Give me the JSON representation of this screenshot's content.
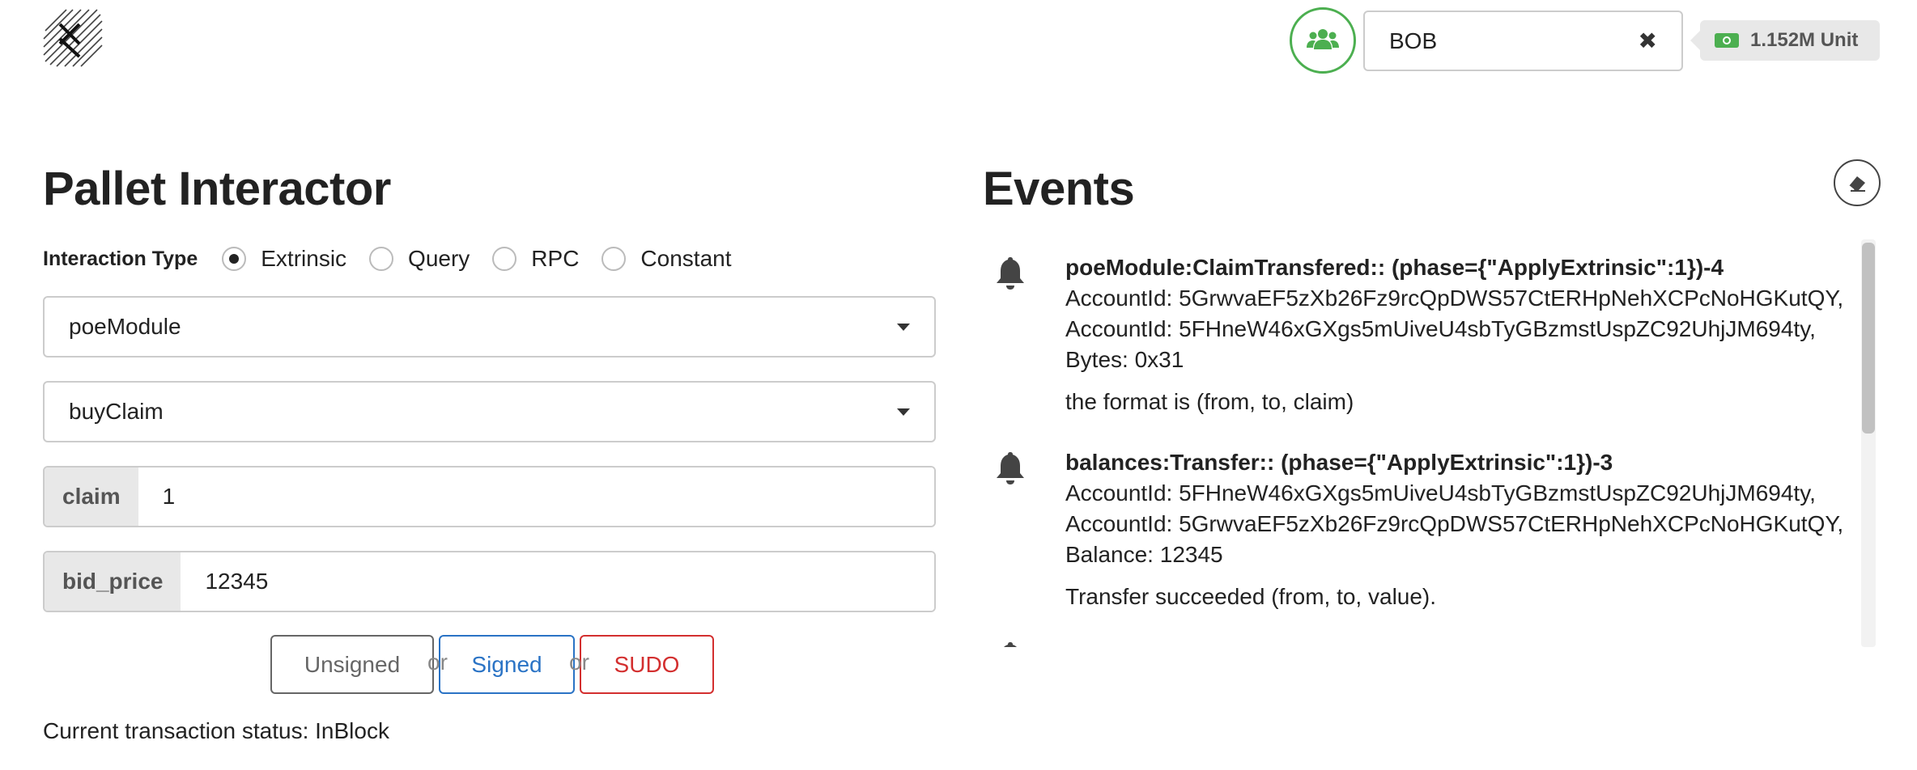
{
  "header": {
    "account_name": "BOB",
    "balance": "1.152M Unit",
    "colors": {
      "accent_green": "#4caf50",
      "signed_blue": "#2a73c5",
      "sudo_red": "#d32f2f"
    },
    "icons": {
      "logo": "logo-icon",
      "accounts": "users-icon",
      "clear": "close-icon",
      "money": "money-icon"
    }
  },
  "pallet": {
    "title": "Pallet Interactor",
    "interaction_type_label": "Interaction Type",
    "interaction_types": [
      {
        "label": "Extrinsic",
        "checked": true
      },
      {
        "label": "Query",
        "checked": false
      },
      {
        "label": "RPC",
        "checked": false
      },
      {
        "label": "Constant",
        "checked": false
      }
    ],
    "module_select": "poeModule",
    "call_select": "buyClaim",
    "params": [
      {
        "label": "claim",
        "value": "1"
      },
      {
        "label": "bid_price",
        "value": "12345"
      }
    ],
    "buttons": {
      "unsigned": "Unsigned",
      "or": "or",
      "signed": "Signed",
      "sudo": "SUDO"
    },
    "status": "Current transaction status: InBlock"
  },
  "events": {
    "title": "Events",
    "items": [
      {
        "head": "poeModule:ClaimTransfered:: (phase={\"ApplyExtrinsic\":1})-4",
        "lines": [
          "AccountId: 5GrwvaEF5zXb26Fz9rcQpDWS57CtERHpNehXCPcNoHGKutQY,",
          "AccountId: 5FHneW46xGXgs5mUiveU4sbTyGBzmstUspZC92UhjJM694ty,",
          "Bytes: 0x31"
        ],
        "summary": "the format is (from, to, claim)"
      },
      {
        "head": "balances:Transfer:: (phase={\"ApplyExtrinsic\":1})-3",
        "lines": [
          "AccountId: 5FHneW46xGXgs5mUiveU4sbTyGBzmstUspZC92UhjJM694ty,",
          "AccountId: 5GrwvaEF5zXb26Fz9rcQpDWS57CtERHpNehXCPcNoHGKutQY,",
          "Balance: 12345"
        ],
        "summary": "Transfer succeeded (from, to, value)."
      }
    ]
  }
}
